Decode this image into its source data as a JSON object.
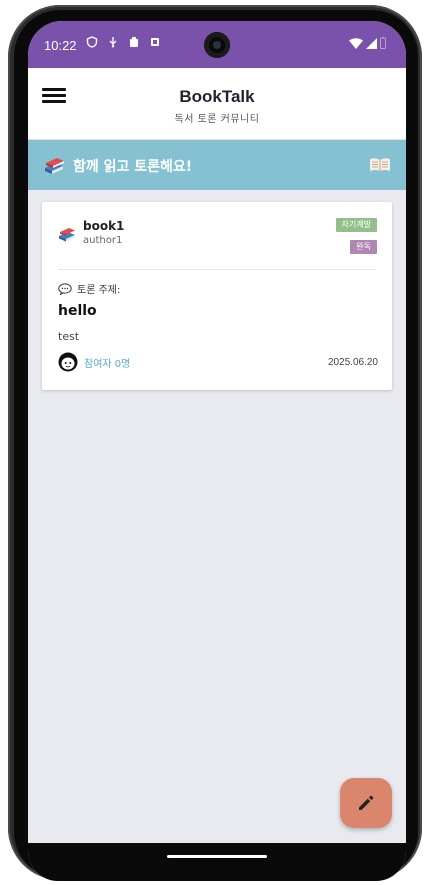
{
  "status_bar": {
    "time": "10:22",
    "color": "#7b52ab"
  },
  "app_bar": {
    "title": "BookTalk",
    "subtitle": "독서 토론 커뮤니티"
  },
  "banner": {
    "text": "함께 읽고 토론해요!",
    "color": "#86c1d2"
  },
  "card": {
    "book_title": "book1",
    "author": "author1",
    "category_tag": "자기계발",
    "status_tag": "완독",
    "topic_label": "토론 주제:",
    "topic_title": "hello",
    "description": "test",
    "participants": "참여자 0명",
    "date": "2025.06.20"
  },
  "fab": {
    "icon": "pencil-icon",
    "color": "#d9866d"
  }
}
